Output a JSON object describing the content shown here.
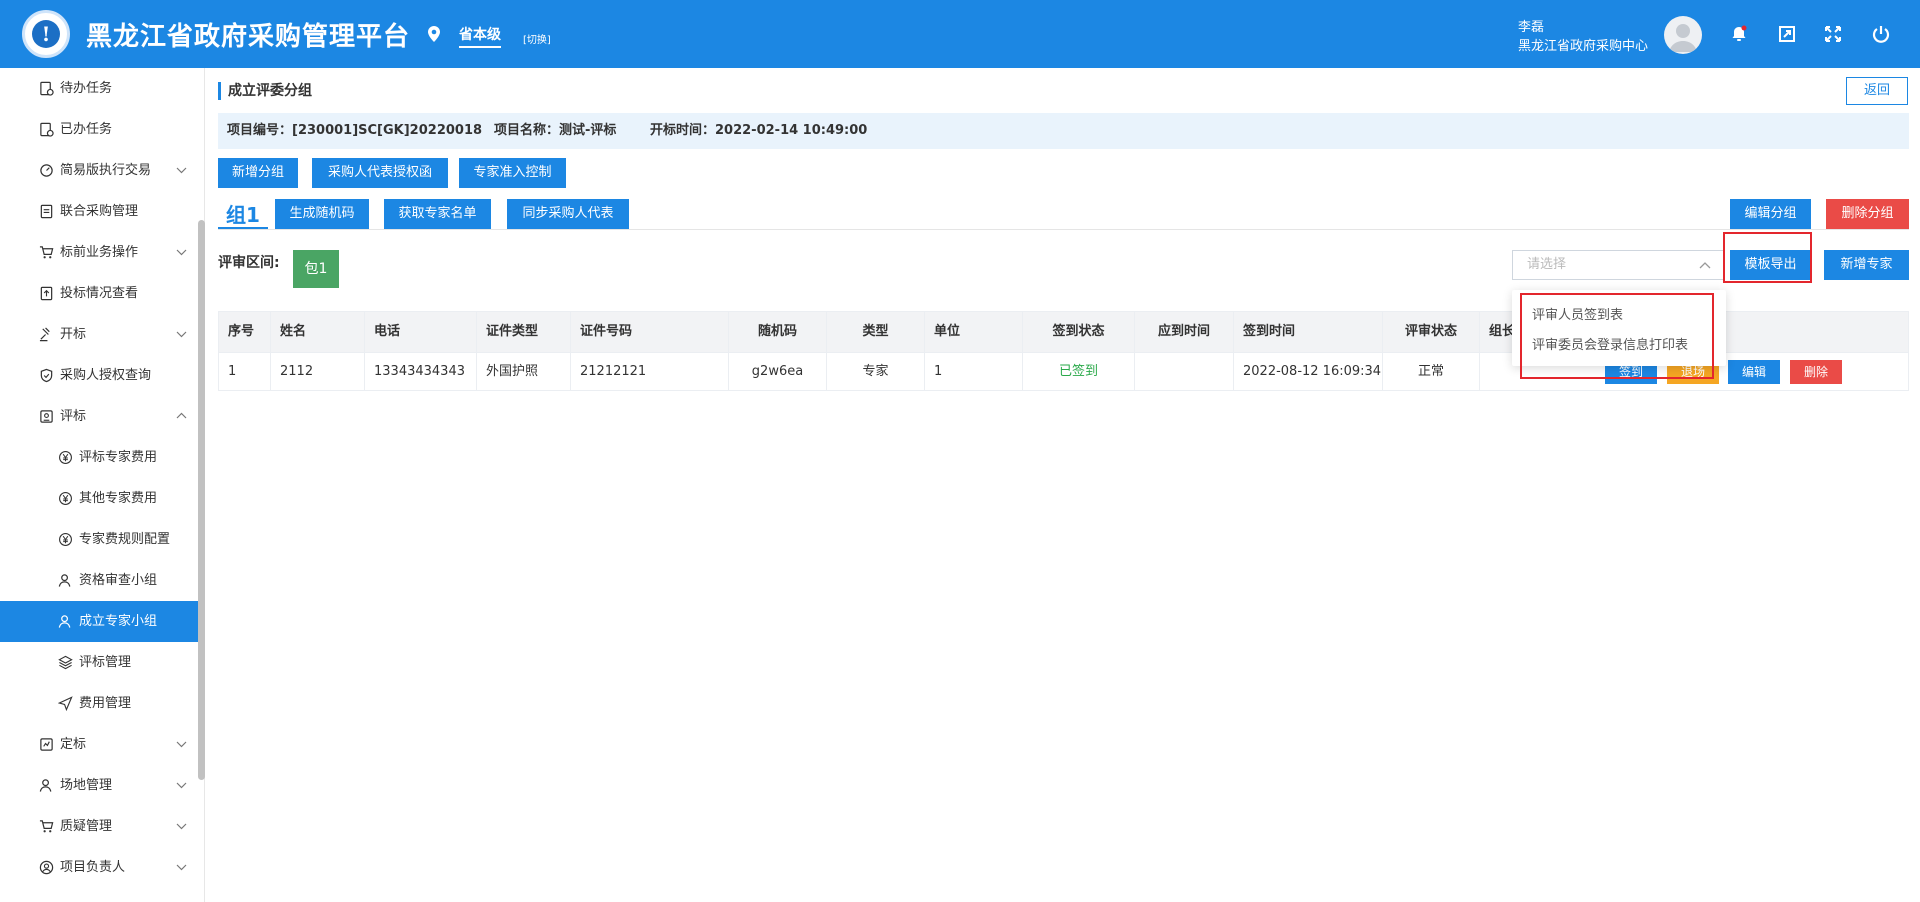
{
  "header": {
    "title": "黑龙江省政府采购管理平台",
    "location": "省本级",
    "switch": "[切换]",
    "user_name": "李磊",
    "user_org": "黑龙江省政府采购中心",
    "logo_glyph": "!"
  },
  "sidebar": {
    "items": [
      {
        "label": "待办任务"
      },
      {
        "label": "已办任务"
      },
      {
        "label": "简易版执行交易"
      },
      {
        "label": "联合采购管理"
      },
      {
        "label": "标前业务操作"
      },
      {
        "label": "投标情况查看"
      },
      {
        "label": "开标"
      },
      {
        "label": "采购人授权查询"
      },
      {
        "label": "评标"
      },
      {
        "label": "评标专家费用"
      },
      {
        "label": "其他专家费用"
      },
      {
        "label": "专家费规则配置"
      },
      {
        "label": "资格审查小组"
      },
      {
        "label": "成立专家小组"
      },
      {
        "label": "评标管理"
      },
      {
        "label": "费用管理"
      },
      {
        "label": "定标"
      },
      {
        "label": "场地管理"
      },
      {
        "label": "质疑管理"
      },
      {
        "label": "项目负责人"
      }
    ]
  },
  "main": {
    "page_title": "成立评委分组",
    "back_label": "返回",
    "info": {
      "project_no": "项目编号：[230001]SC[GK]20220018",
      "project_name": "项目名称：测试-评标",
      "open_time": "开标时间：2022-02-14 10:49:00"
    },
    "toolbar": {
      "add_group": "新增分组",
      "purchaser_auth": "采购人代表授权函",
      "expert_access": "专家准入控制"
    },
    "group": {
      "tab_label": "组1",
      "gen_random": "生成随机码",
      "get_list": "获取专家名单",
      "sync_rep": "同步采购人代表",
      "edit_group": "编辑分组",
      "delete_group": "删除分组"
    },
    "review_range_label": "评审区间:",
    "package_badge": "包1",
    "template_select": {
      "placeholder": "请选择",
      "options": [
        "评审人员签到表",
        "评审委员会登录信息打印表"
      ]
    },
    "template_export": "模板导出",
    "add_expert": "新增专家",
    "table": {
      "headers": [
        "序号",
        "姓名",
        "电话",
        "证件类型",
        "证件号码",
        "随机码",
        "类型",
        "单位",
        "签到状态",
        "应到时间",
        "签到时间",
        "评审状态",
        "组长"
      ],
      "rows": [
        {
          "cells": [
            "1",
            "2112",
            "13343434343",
            "外国护照",
            "21212121",
            "g2w6ea",
            "专家",
            "1",
            "已签到",
            "",
            "2022-08-12 16:09:34",
            "正常",
            ""
          ],
          "actions": {
            "sign": "签到",
            "leave": "退场",
            "edit": "编辑",
            "delete": "删除"
          }
        }
      ]
    }
  },
  "colors": {
    "primary": "#1c87e3",
    "danger": "#ea4b47",
    "success": "#4aa564",
    "warning": "#f5a623",
    "highlight": "#e3262d"
  }
}
